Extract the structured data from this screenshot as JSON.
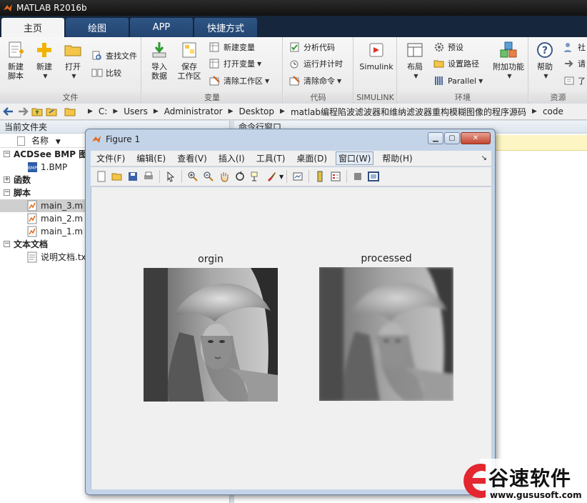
{
  "app": {
    "title": "MATLAB R2016b"
  },
  "tabs": [
    {
      "label": "主页",
      "active": true
    },
    {
      "label": "绘图",
      "active": false
    },
    {
      "label": "APP",
      "active": false
    },
    {
      "label": "快捷方式",
      "active": false
    }
  ],
  "ribbon": {
    "file": {
      "label": "文件",
      "new_script": "新建\n脚本",
      "new": "新建",
      "open": "打开",
      "find_files": "查找文件",
      "compare": "比较"
    },
    "variable": {
      "label": "变量",
      "import": "导入\n数据",
      "save_ws": "保存\n工作区",
      "new_var": "新建变量",
      "open_var": "打开变量",
      "clear_ws": "清除工作区"
    },
    "code": {
      "label": "代码",
      "analyze": "分析代码",
      "run_time": "运行并计时",
      "clear_cmd": "清除命令"
    },
    "simulink": {
      "label": "SIMULINK",
      "button": "Simulink"
    },
    "env": {
      "label": "环境",
      "layout": "布局",
      "prefs": "预设",
      "set_path": "设置路径",
      "parallel": "Parallel",
      "addons": "附加功能"
    },
    "resources": {
      "label": "资源",
      "help": "帮助",
      "community": "社",
      "request": "请",
      "learn": "了"
    }
  },
  "address": {
    "crumbs": [
      "C:",
      "Users",
      "Administrator",
      "Desktop",
      "matlab编程陷波滤波器和维纳滤波器重构模糊图像的程序源码",
      "code"
    ]
  },
  "files_panel": {
    "title": "当前文件夹",
    "col_name": "名称",
    "groups": [
      {
        "name": "ACDSee BMP 图像",
        "files": [
          "1.BMP"
        ]
      },
      {
        "name": "函数",
        "files": []
      },
      {
        "name": "脚本",
        "files": [
          "main_3.m",
          "main_2.m",
          "main_1.m"
        ]
      },
      {
        "name": "文本文档",
        "files": [
          "说明文档.txt"
        ]
      }
    ],
    "selected": "main_3.m"
  },
  "command_panel": {
    "title": "命令行窗口"
  },
  "figure": {
    "title": "Figure 1",
    "menu": [
      "文件(F)",
      "编辑(E)",
      "查看(V)",
      "插入(I)",
      "工具(T)",
      "桌面(D)",
      "窗口(W)",
      "帮助(H)"
    ],
    "active_menu": "窗口(W)",
    "axes": [
      {
        "title": "orgin"
      },
      {
        "title": "processed"
      }
    ]
  },
  "watermark": {
    "text": "谷速软件",
    "url": "www.gususoft.com"
  },
  "colors": {
    "tab_bar": "#16273d",
    "close_button": "#c2452f",
    "watermark_red": "#e3262f"
  }
}
